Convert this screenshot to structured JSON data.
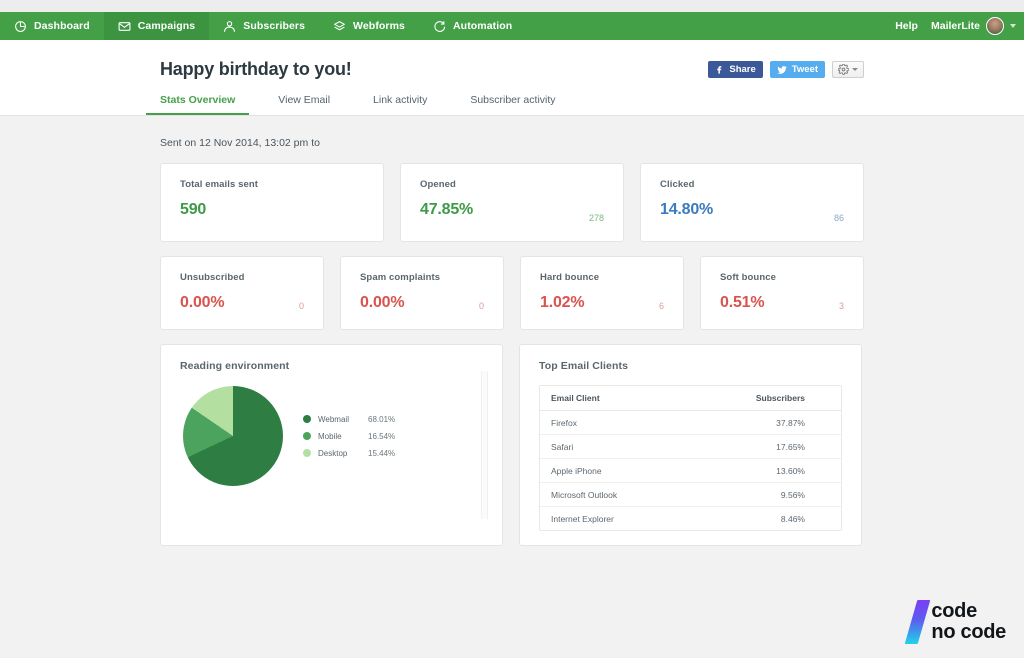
{
  "nav": {
    "items": [
      {
        "label": "Dashboard",
        "icon": "pie-clock-icon",
        "active": false
      },
      {
        "label": "Campaigns",
        "icon": "envelope-icon",
        "active": true
      },
      {
        "label": "Subscribers",
        "icon": "person-icon",
        "active": false
      },
      {
        "label": "Webforms",
        "icon": "layers-icon",
        "active": false
      },
      {
        "label": "Automation",
        "icon": "refresh-icon",
        "active": false
      }
    ],
    "help_label": "Help",
    "user_name": "MailerLite",
    "bg_color": "#43a047"
  },
  "header": {
    "title": "Happy birthday to you!",
    "share_label": "Share",
    "tweet_label": "Tweet",
    "share_color": "#3b5998",
    "tweet_color": "#55acee",
    "tabs": [
      {
        "label": "Stats Overview",
        "active": true
      },
      {
        "label": "View Email",
        "active": false
      },
      {
        "label": "Link activity",
        "active": false
      },
      {
        "label": "Subscriber activity",
        "active": false
      }
    ]
  },
  "main": {
    "sent_line": "Sent on 12 Nov 2014, 13:02 pm to",
    "primary_stats": [
      {
        "label": "Total emails sent",
        "value": "590",
        "count": "",
        "tone": "green"
      },
      {
        "label": "Opened",
        "value": "47.85%",
        "count": "278",
        "tone": "green"
      },
      {
        "label": "Clicked",
        "value": "14.80%",
        "count": "86",
        "tone": "blue"
      }
    ],
    "secondary_stats": [
      {
        "label": "Unsubscribed",
        "value": "0.00%",
        "count": "0",
        "tone": "red"
      },
      {
        "label": "Spam complaints",
        "value": "0.00%",
        "count": "0",
        "tone": "red"
      },
      {
        "label": "Hard bounce",
        "value": "1.02%",
        "count": "6",
        "tone": "red"
      },
      {
        "label": "Soft bounce",
        "value": "0.51%",
        "count": "3",
        "tone": "red"
      }
    ],
    "reading_environment": {
      "title": "Reading environment"
    },
    "top_email_clients": {
      "title": "Top Email Clients",
      "columns": [
        "Email Client",
        "Subscribers"
      ],
      "rows": [
        {
          "client": "Firefox",
          "subscribers": "37.87%"
        },
        {
          "client": "Safari",
          "subscribers": "17.65%"
        },
        {
          "client": "Apple iPhone",
          "subscribers": "13.60%"
        },
        {
          "client": "Microsoft Outlook",
          "subscribers": "9.56%"
        },
        {
          "client": "Internet Explorer",
          "subscribers": "8.46%"
        }
      ]
    }
  },
  "chart_data": {
    "type": "pie",
    "title": "Reading environment",
    "categories": [
      "Webmail",
      "Mobile",
      "Desktop"
    ],
    "values": [
      68.01,
      16.54,
      15.44
    ],
    "value_labels": [
      "68.01%",
      "16.54%",
      "15.44%"
    ],
    "colors": [
      "#2e7d42",
      "#4ca35d",
      "#b3e0a0"
    ],
    "legend": "right",
    "unit": "percent",
    "start_angle_deg": 0,
    "direction": "clockwise"
  },
  "watermark": {
    "line1": "code",
    "line2": "no code"
  }
}
